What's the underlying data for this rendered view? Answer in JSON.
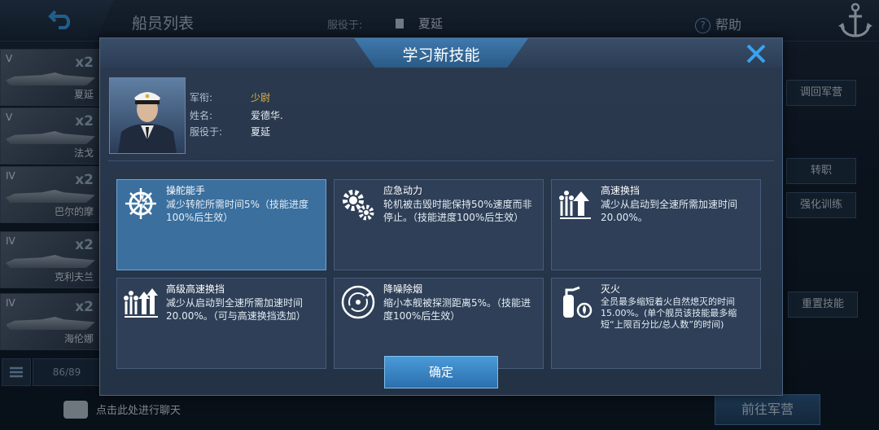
{
  "header": {
    "title": "船员列表",
    "serving_label": "服役于:",
    "serving_ship": "夏延",
    "help_label": "帮助"
  },
  "crew_list": [
    {
      "tier": "V",
      "multiplier": "x2",
      "ship": "夏延"
    },
    {
      "tier": "V",
      "multiplier": "x2",
      "ship": "法戈"
    },
    {
      "tier": "IV",
      "multiplier": "x2",
      "ship": "巴尔的摩"
    },
    {
      "tier": "IV",
      "multiplier": "x2",
      "ship": "克利夫兰"
    },
    {
      "tier": "IV",
      "multiplier": "x2",
      "ship": "海伦娜"
    }
  ],
  "list_count": "86/89",
  "chat_prompt": "点击此处进行聊天",
  "side_buttons": {
    "recall": "调回军营",
    "transfer": "转职",
    "train": "强化训练",
    "reset": "重置技能",
    "goto_barracks": "前往军营"
  },
  "modal": {
    "title": "学习新技能",
    "rank_label": "军衔:",
    "rank_value": "少尉",
    "name_label": "姓名:",
    "name_value": "爱德华.",
    "serving_label": "服役于:",
    "serving_value": "夏延",
    "confirm_label": "确定",
    "skills": [
      {
        "name": "操舵能手",
        "desc": "减少转舵所需时间5%（技能进度100%后生效）",
        "icon": "ship-wheel-icon",
        "selected": true
      },
      {
        "name": "应急动力",
        "desc": "轮机被击毁时能保持50%速度而非停止。（技能进度100%后生效）",
        "icon": "gears-icon",
        "selected": false
      },
      {
        "name": "高速换挡",
        "desc": "减少从启动到全速所需加速时间20.00%。",
        "icon": "speed-gauge-icon",
        "selected": false
      },
      {
        "name": "高级高速换挡",
        "desc": "减少从启动到全速所需加速时间20.00%。（可与高速换挡迭加）",
        "icon": "advanced-speed-icon",
        "selected": false
      },
      {
        "name": "降噪除烟",
        "desc": "缩小本舰被探测距离5%。（技能进度100%后生效）",
        "icon": "radar-icon",
        "selected": false
      },
      {
        "name": "灭火",
        "desc": "全员最多缩短着火自然熄灭的时间15.00%。(单个舰员该技能最多缩短“上限百分比/总人数”的时间)",
        "icon": "fire-extinguisher-icon",
        "selected": false
      }
    ]
  },
  "colors": {
    "accent": "#3a6f9e",
    "rank_gold": "#e3b43e",
    "close_blue": "#3aa2f0"
  }
}
